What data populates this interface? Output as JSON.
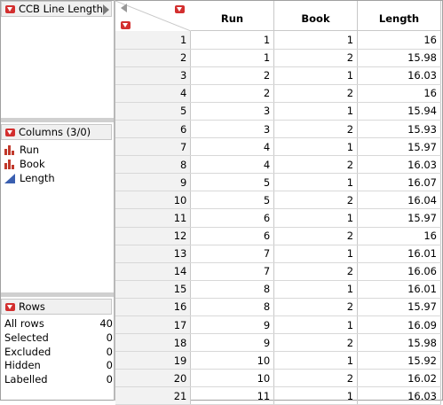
{
  "left_panel": {
    "table_name": "CCB Line Length",
    "columns_header": "Columns (3/0)",
    "columns": [
      {
        "name": "Run",
        "icon": "nominal-icon"
      },
      {
        "name": "Book",
        "icon": "nominal-icon"
      },
      {
        "name": "Length",
        "icon": "continuous-icon"
      }
    ],
    "rows_header": "Rows",
    "rows_stats": [
      {
        "label": "All rows",
        "value": "40"
      },
      {
        "label": "Selected",
        "value": "0"
      },
      {
        "label": "Excluded",
        "value": "0"
      },
      {
        "label": "Hidden",
        "value": "0"
      },
      {
        "label": "Labelled",
        "value": "0"
      }
    ]
  },
  "grid": {
    "headers": [
      "Run",
      "Book",
      "Length"
    ],
    "rows": [
      [
        "1",
        "1",
        "1",
        "16"
      ],
      [
        "2",
        "1",
        "2",
        "15.98"
      ],
      [
        "3",
        "2",
        "1",
        "16.03"
      ],
      [
        "4",
        "2",
        "2",
        "16"
      ],
      [
        "5",
        "3",
        "1",
        "15.94"
      ],
      [
        "6",
        "3",
        "2",
        "15.93"
      ],
      [
        "7",
        "4",
        "1",
        "15.97"
      ],
      [
        "8",
        "4",
        "2",
        "16.03"
      ],
      [
        "9",
        "5",
        "1",
        "16.07"
      ],
      [
        "10",
        "5",
        "2",
        "16.04"
      ],
      [
        "11",
        "6",
        "1",
        "15.97"
      ],
      [
        "12",
        "6",
        "2",
        "16"
      ],
      [
        "13",
        "7",
        "1",
        "16.01"
      ],
      [
        "14",
        "7",
        "2",
        "16.06"
      ],
      [
        "15",
        "8",
        "1",
        "16.01"
      ],
      [
        "16",
        "8",
        "2",
        "15.97"
      ],
      [
        "17",
        "9",
        "1",
        "16.09"
      ],
      [
        "18",
        "9",
        "2",
        "15.98"
      ],
      [
        "19",
        "10",
        "1",
        "15.92"
      ],
      [
        "20",
        "10",
        "2",
        "16.02"
      ],
      [
        "21",
        "11",
        "1",
        "16.03"
      ]
    ]
  },
  "colors": {
    "menu_triangle": "#d32f2f",
    "nominal_icon": "#c0392b",
    "continuous_icon": "#3a5fb0",
    "row_header_bg": "#f2f2f2"
  }
}
